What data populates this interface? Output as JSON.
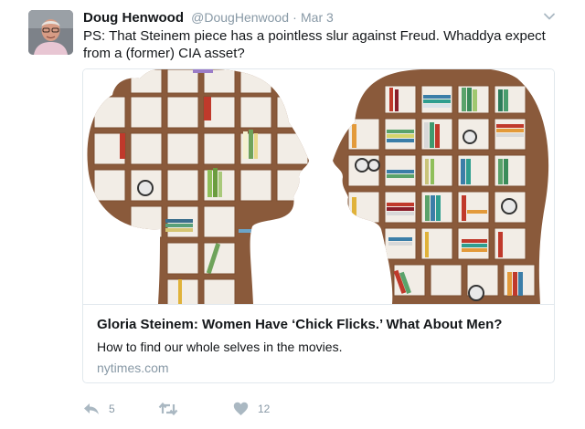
{
  "tweet": {
    "author_name": "Doug Henwood",
    "author_handle": "@DougHenwood",
    "separator": "·",
    "timestamp": "Mar 3",
    "text": "PS: That Steinem piece has a pointless slur against Freud. Whaddya expect from a (former) CIA asset?"
  },
  "card": {
    "title": "Gloria Steinem: Women Have ‘Chick Flicks.’ What About Men?",
    "description": "How to find our whole selves in the movies.",
    "domain": "nytimes.com"
  },
  "actions": {
    "reply_count": "5",
    "retweet_count": "",
    "like_count": "12"
  },
  "icons": {
    "avatar": "profile-photo",
    "caret": "chevron-down-icon",
    "reply": "reply-icon",
    "retweet": "retweet-icon",
    "like": "heart-icon"
  },
  "colors": {
    "text_primary": "#14171a",
    "text_secondary": "#8899a6",
    "card_border": "#e1e8ed",
    "shelf_wood": "#a4734f",
    "icon_gray": "#aab8c2"
  }
}
